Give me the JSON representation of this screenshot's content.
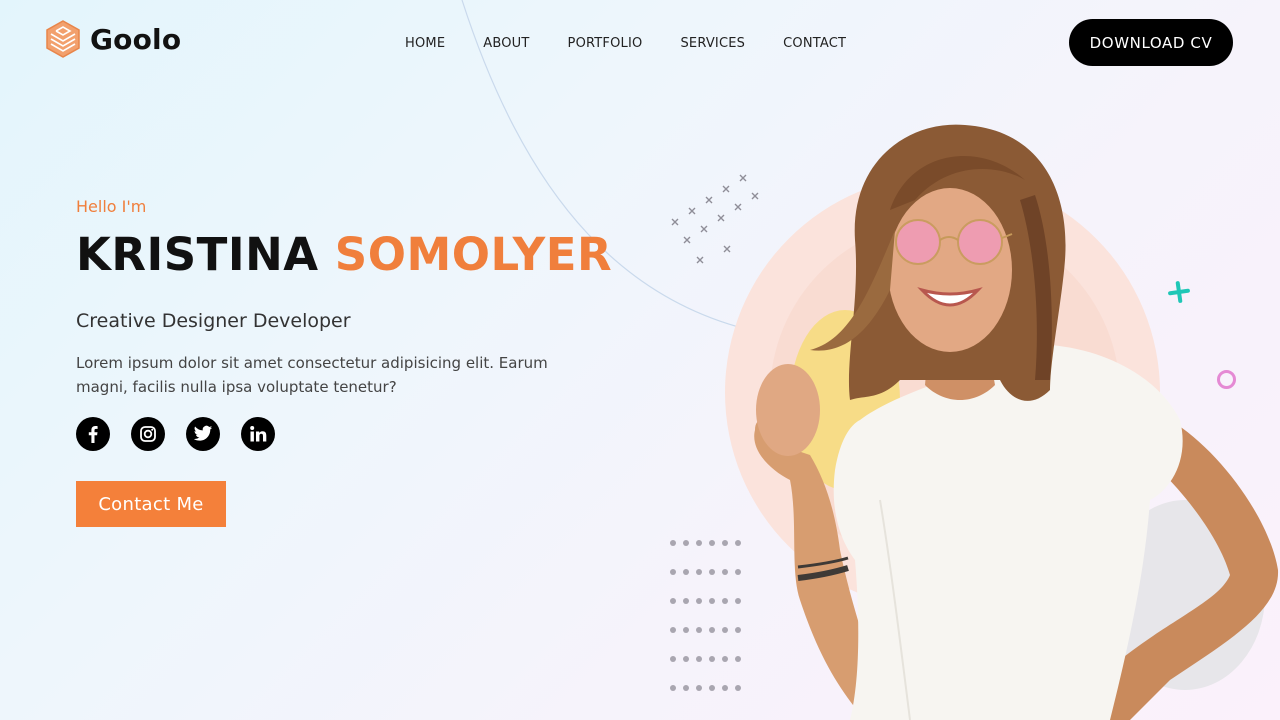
{
  "brand": {
    "name": "Goolo",
    "accent": "#f07f3c",
    "icon": "layered-hexagon-logo-icon"
  },
  "nav": {
    "items": [
      {
        "label": "HOME"
      },
      {
        "label": "ABOUT"
      },
      {
        "label": "PORTFOLIO"
      },
      {
        "label": "SERVICES"
      },
      {
        "label": "CONTACT"
      }
    ]
  },
  "header": {
    "cta_label": "DOWNLOAD CV"
  },
  "hero": {
    "greeting": "Hello I'm",
    "first_name": "KRISTINA",
    "last_name": "SOMOLYER",
    "role": "Creative Designer Developer",
    "description": "Lorem ipsum dolor sit amet consectetur adipisicing elit. Earum magni, facilis nulla ipsa voluptate tenetur?",
    "socials": [
      {
        "name": "facebook",
        "icon": "facebook-icon"
      },
      {
        "name": "instagram",
        "icon": "instagram-icon"
      },
      {
        "name": "twitter",
        "icon": "twitter-icon"
      },
      {
        "name": "linkedin",
        "icon": "linkedin-icon"
      }
    ],
    "contact_label": "Contact Me",
    "image_alt": "Smiling woman with pink round sunglasses in white t-shirt"
  },
  "colors": {
    "accent_orange": "#f07f3c",
    "button_orange": "#f4803a",
    "teal": "#1fc7b6",
    "pink": "#e58ad4",
    "dark": "#000000"
  }
}
